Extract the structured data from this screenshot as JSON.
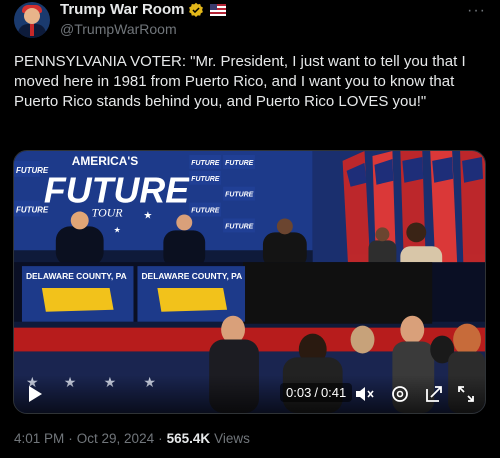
{
  "account": {
    "display_name": "Trump War Room",
    "handle": "@TrumpWarRoom",
    "verified_icon": "gold-verified-badge-icon",
    "affiliate_icon": "flag-badge-icon",
    "avatar_icon": "profile-avatar"
  },
  "menu": {
    "more_label": "···"
  },
  "tweet": {
    "text": "PENNSYLVANIA VOTER: \"Mr. President, I just want to tell you that I moved here in 1981 from Puerto Rico, and I want you to know that Puerto Rico stands behind you, and Puerto Rico LOVES you!\""
  },
  "video": {
    "backdrop": {
      "title_line1": "AMERICA'S",
      "title_line2": "FUTURE",
      "title_line3": "TOUR",
      "tile_label": "FUTURE",
      "tile_small": "TOUR"
    },
    "table_signs": [
      "DELAWARE COUNTY, PA",
      "DELAWARE COUNTY, PA"
    ],
    "current_time": "0:03",
    "separator": "/",
    "duration": "0:41",
    "icons": [
      "play-icon",
      "mute-icon",
      "settings-icon",
      "popout-icon",
      "fullscreen-icon"
    ]
  },
  "meta": {
    "time": "4:01 PM",
    "dot1": "·",
    "date": "Oct 29, 2024",
    "dot2": "·",
    "views_count": "565.4K",
    "views_label": "Views"
  },
  "colors": {
    "background": "#000000",
    "text": "#e7e9ea",
    "secondary": "#71767b",
    "verified_gold": "#e2b719",
    "backdrop_blue": "#1d3a8a",
    "sign_yellow": "#f2c21b"
  }
}
